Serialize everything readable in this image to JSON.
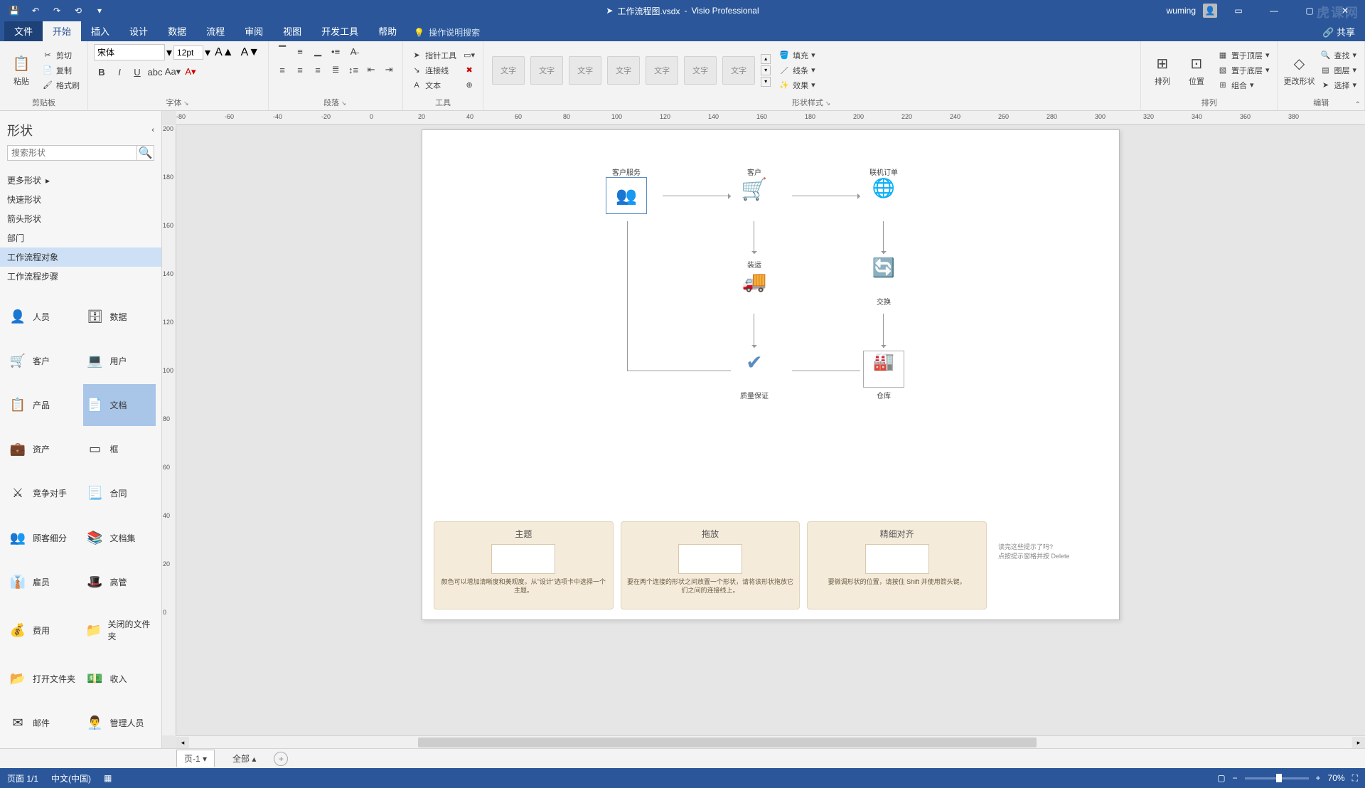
{
  "app": {
    "filename": "工作流程图.vsdx",
    "product": "Visio Professional",
    "user": "wuming"
  },
  "qat": {
    "save": "💾",
    "undo": "↶",
    "redo": "↷",
    "refresh": "⟲"
  },
  "tabs": {
    "file": "文件",
    "home": "开始",
    "insert": "插入",
    "design": "设计",
    "data": "数据",
    "process": "流程",
    "review": "审阅",
    "view": "视图",
    "dev": "开发工具",
    "help": "帮助",
    "tell": "操作说明搜索",
    "share": "共享"
  },
  "ribbon": {
    "clipboard": {
      "label": "剪贴板",
      "paste": "粘贴",
      "cut": "剪切",
      "copy": "复制",
      "format_painter": "格式刷"
    },
    "font": {
      "label": "字体",
      "name": "宋体",
      "size": "12pt"
    },
    "paragraph": {
      "label": "段落"
    },
    "tools": {
      "label": "工具",
      "pointer": "指针工具",
      "connector": "连接线",
      "text": "文本"
    },
    "styles": {
      "label": "形状样式",
      "swatch": "文字",
      "fill": "填充",
      "line": "线条",
      "effect": "效果"
    },
    "arrange": {
      "label": "排列",
      "align": "排列",
      "position": "位置",
      "bring_front": "置于顶层",
      "send_back": "置于底层",
      "group": "组合"
    },
    "edit": {
      "label": "编辑",
      "change_shape": "更改形状",
      "find": "查找",
      "layer": "图层",
      "select": "选择"
    }
  },
  "shapes_pane": {
    "title": "形状",
    "search_placeholder": "搜索形状",
    "more": "更多形状",
    "quick": "快速形状",
    "arrow": "箭头形状",
    "dept": "部门",
    "wf_obj": "工作流程对象",
    "wf_step": "工作流程步骤",
    "items": [
      {
        "name": "人员",
        "icon": "👤",
        "col": 1
      },
      {
        "name": "数据",
        "icon": "🗄",
        "col": 2
      },
      {
        "name": "客户",
        "icon": "🛒",
        "col": 1
      },
      {
        "name": "用户",
        "icon": "💻",
        "col": 2
      },
      {
        "name": "产品",
        "icon": "📋",
        "col": 1
      },
      {
        "name": "文档",
        "icon": "📄",
        "col": 2,
        "sel": true
      },
      {
        "name": "资产",
        "icon": "💼",
        "col": 1
      },
      {
        "name": "框",
        "icon": "▭",
        "col": 2
      },
      {
        "name": "竞争对手",
        "icon": "⚔",
        "col": 1
      },
      {
        "name": "合同",
        "icon": "📃",
        "col": 2
      },
      {
        "name": "顾客细分",
        "icon": "👥",
        "col": 1
      },
      {
        "name": "文档集",
        "icon": "📚",
        "col": 2
      },
      {
        "name": "雇员",
        "icon": "👔",
        "col": 1
      },
      {
        "name": "高管",
        "icon": "🎩",
        "col": 2
      },
      {
        "name": "费用",
        "icon": "💰",
        "col": 1
      },
      {
        "name": "关闭的文件夹",
        "icon": "📁",
        "col": 2
      },
      {
        "name": "打开文件夹",
        "icon": "📂",
        "col": 1
      },
      {
        "name": "收入",
        "icon": "💵",
        "col": 2
      },
      {
        "name": "邮件",
        "icon": "✉",
        "col": 1
      },
      {
        "name": "管理人员",
        "icon": "👨‍💼",
        "col": 2
      }
    ]
  },
  "ruler_h": [
    -80,
    -60,
    -40,
    -20,
    0,
    20,
    40,
    60,
    80,
    100,
    120,
    140,
    160,
    180,
    200,
    220,
    240,
    260,
    280,
    300,
    320,
    340,
    360,
    380
  ],
  "ruler_v": [
    200,
    180,
    160,
    140,
    120,
    100,
    80,
    60,
    40,
    20,
    0
  ],
  "diagram": {
    "customer_service": "客户服务",
    "customer": "客户",
    "online_order": "联机订单",
    "shipping": "装运",
    "delivery": "交换",
    "qa": "质量保证",
    "warehouse": "仓库"
  },
  "tips": {
    "theme": {
      "title": "主题",
      "text": "颜色可以增加清晰度和美观度。从\"设计\"选项卡中选择一个主题。"
    },
    "drag": {
      "title": "拖放",
      "text": "要在两个连接的形状之间放置一个形状，请将该形状拖放它们之间的连接线上。"
    },
    "align": {
      "title": "精细对齐",
      "text": "要微调形状的位置，请按住 Shift 并使用箭头键。"
    },
    "sidehint1": "读完这些提示了吗?",
    "sidehint2": "点按提示窗格并按 Delete"
  },
  "pagetabs": {
    "page1": "页-1",
    "all": "全部"
  },
  "status": {
    "page": "页面 1/1",
    "lang": "中文(中国)",
    "zoom": "70%"
  }
}
